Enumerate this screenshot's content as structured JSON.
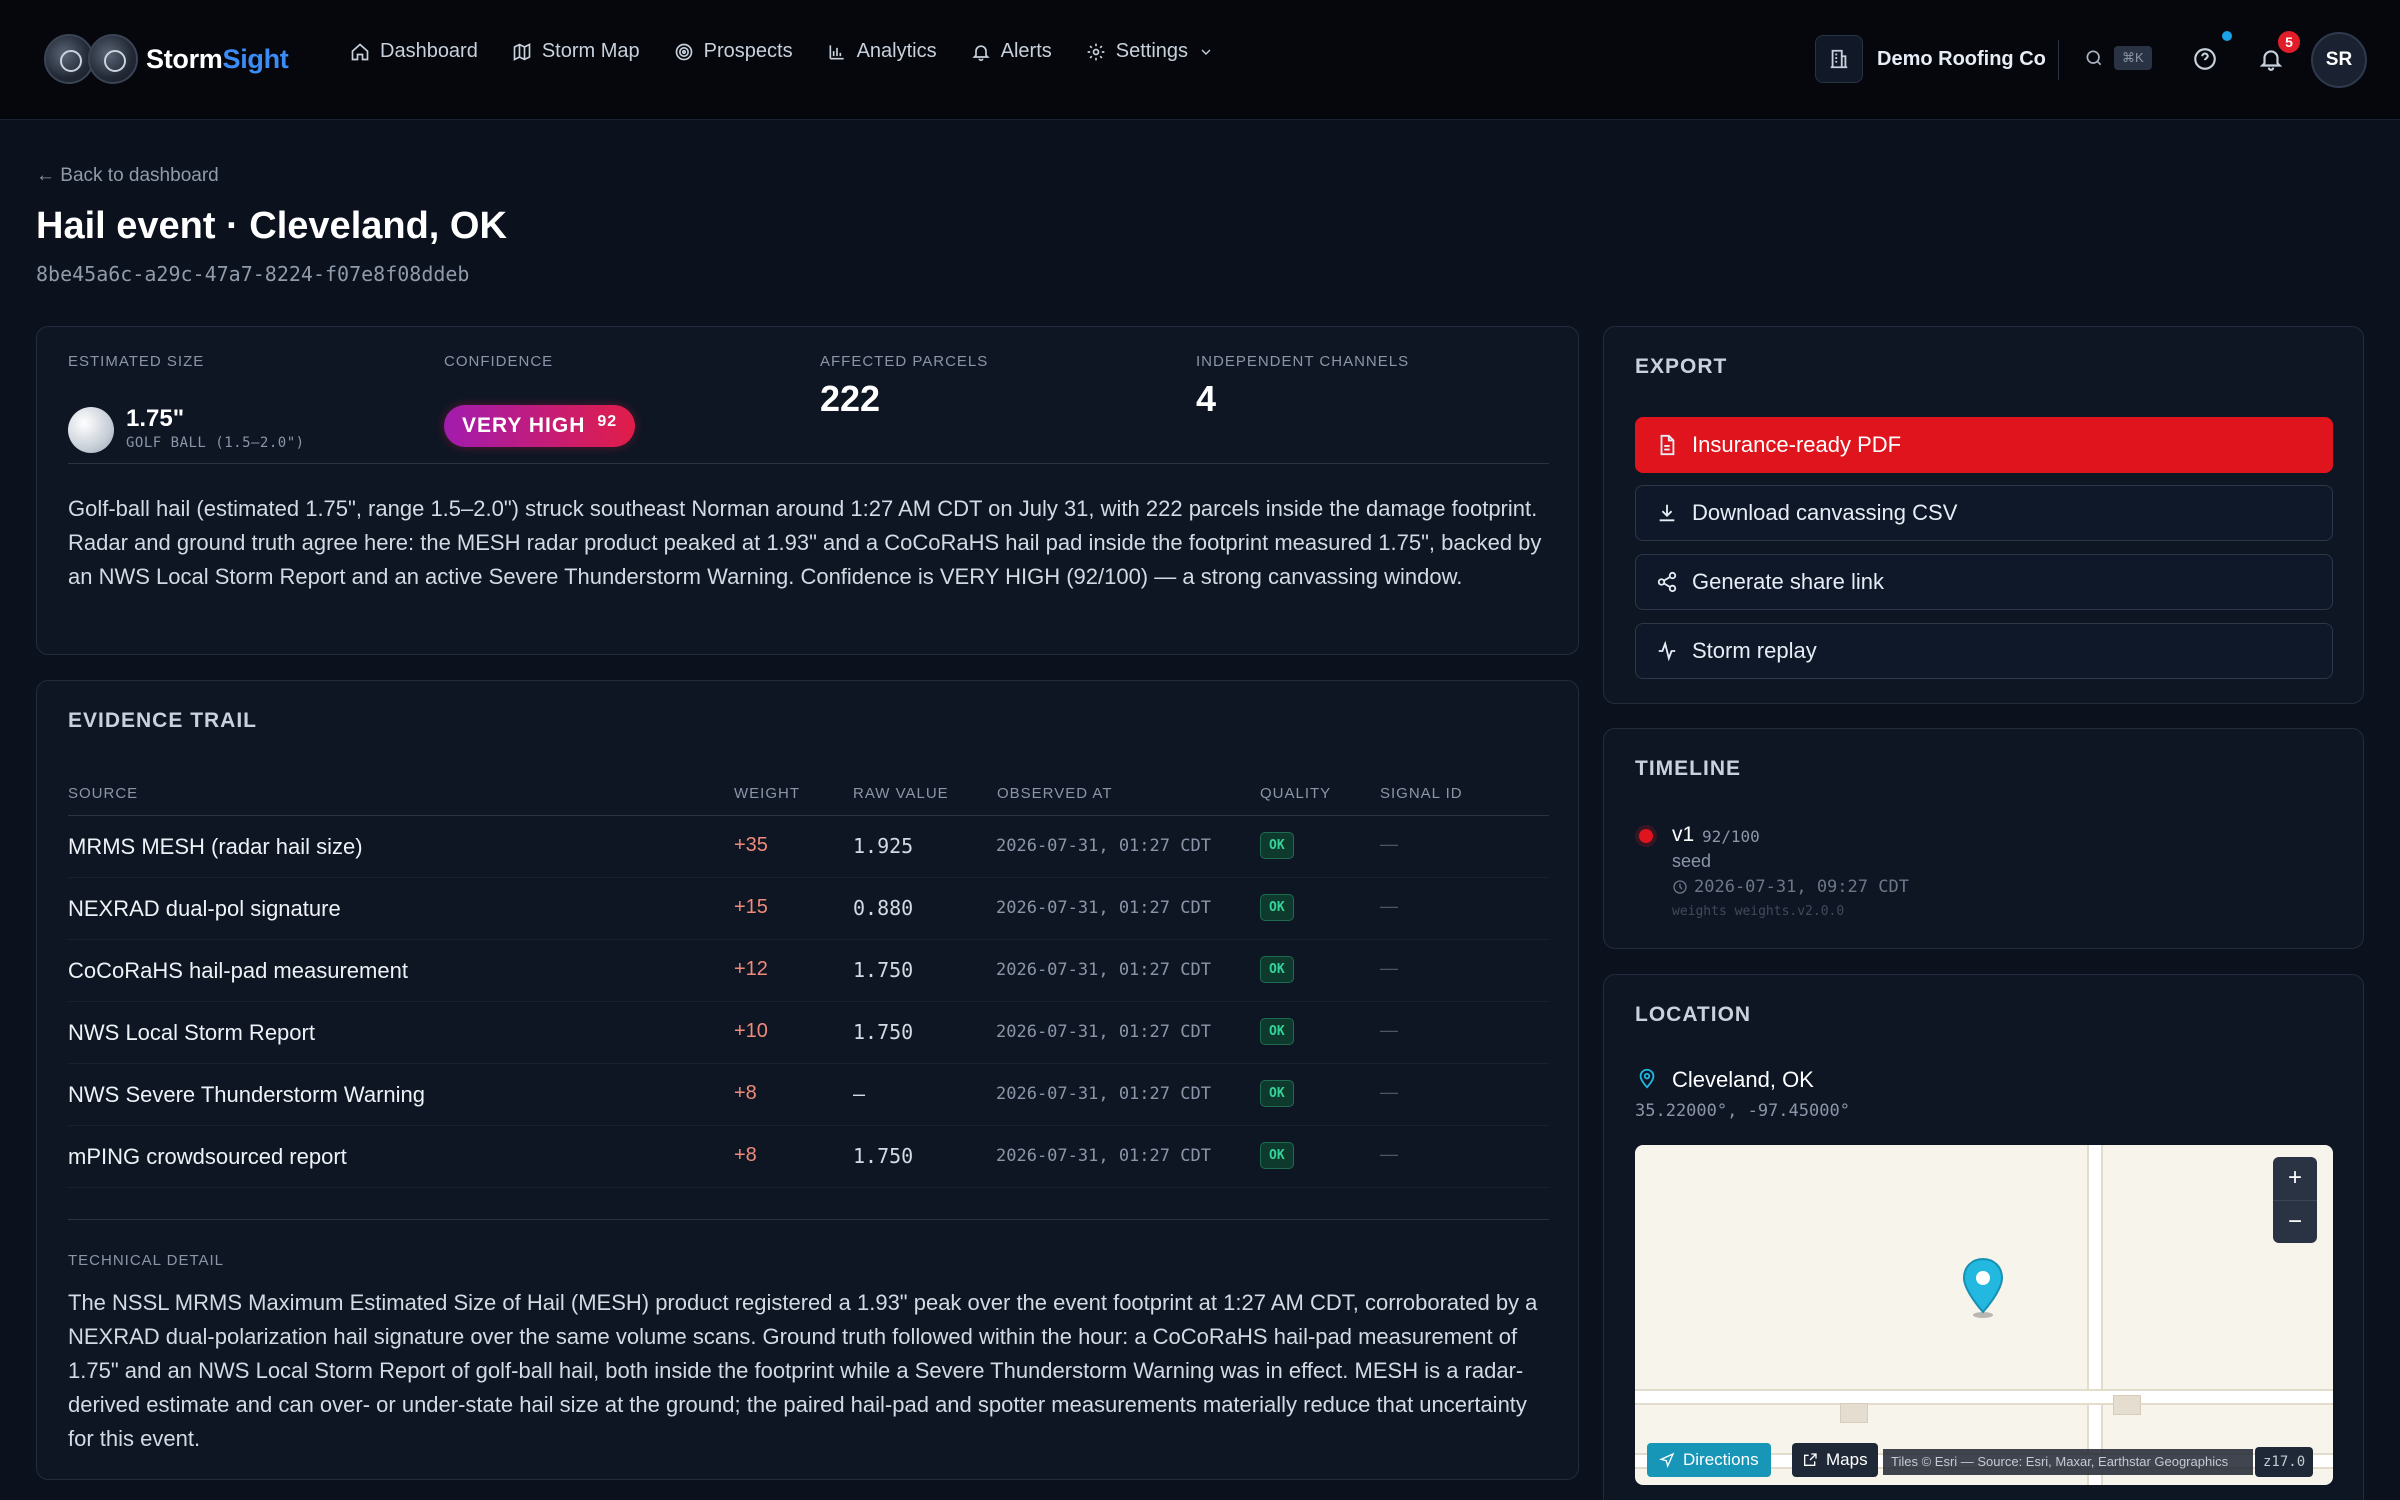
{
  "app": {
    "name_main": "Storm",
    "name_accent": "Sight"
  },
  "nav": [
    {
      "label": "Dashboard",
      "icon": "home-icon"
    },
    {
      "label": "Storm Map",
      "icon": "map-icon"
    },
    {
      "label": "Prospects",
      "icon": "target-icon"
    },
    {
      "label": "Analytics",
      "icon": "bar-chart-icon"
    },
    {
      "label": "Alerts",
      "icon": "bell-icon"
    },
    {
      "label": "Settings",
      "icon": "gear-icon"
    }
  ],
  "org": {
    "name": "Demo Roofing Co"
  },
  "search": {
    "shortcut": "⌘K"
  },
  "notifications": {
    "count": "5"
  },
  "user": {
    "initials": "SR"
  },
  "header": {
    "back": "← Back to dashboard",
    "title": "Hail event · Cleveland, OK",
    "event_id": "8be45a6c-a29c-47a7-8224-f07e8f08ddeb"
  },
  "summary": {
    "size_label": "ESTIMATED SIZE",
    "size_value": "1.75\"",
    "size_desc": "GOLF BALL (1.5–2.0\")",
    "confidence_label": "CONFIDENCE",
    "confidence_value": "VERY HIGH",
    "confidence_score": "92",
    "parcels_label": "AFFECTED PARCELS",
    "parcels_value": "222",
    "channels_label": "INDEPENDENT CHANNELS",
    "channels_value": "4",
    "narrative": "Golf-ball hail (estimated 1.75\", range 1.5–2.0\") struck southeast Norman around 1:27 AM CDT on July 31, with 222 parcels inside the damage footprint. Radar and ground truth agree here: the MESH radar product peaked at 1.93\" and a CoCoRaHS hail pad inside the footprint measured 1.75\", backed by an NWS Local Storm Report and an active Severe Thunderstorm Warning. Confidence is VERY HIGH (92/100) — a strong canvassing window."
  },
  "evidence": {
    "title": "EVIDENCE TRAIL",
    "columns": [
      "SOURCE",
      "WEIGHT",
      "RAW VALUE",
      "OBSERVED AT",
      "QUALITY",
      "SIGNAL ID"
    ],
    "rows": [
      {
        "source": "MRMS MESH (radar hail size)",
        "weight": "+35",
        "raw": "1.925",
        "observed": "2026-07-31, 01:27 CDT",
        "quality": "OK",
        "signal": "—"
      },
      {
        "source": "NEXRAD dual-pol signature",
        "weight": "+15",
        "raw": "0.880",
        "observed": "2026-07-31, 01:27 CDT",
        "quality": "OK",
        "signal": "—"
      },
      {
        "source": "CoCoRaHS hail-pad measurement",
        "weight": "+12",
        "raw": "1.750",
        "observed": "2026-07-31, 01:27 CDT",
        "quality": "OK",
        "signal": "—"
      },
      {
        "source": "NWS Local Storm Report",
        "weight": "+10",
        "raw": "1.750",
        "observed": "2026-07-31, 01:27 CDT",
        "quality": "OK",
        "signal": "—"
      },
      {
        "source": "NWS Severe Thunderstorm Warning",
        "weight": "+8",
        "raw": "—",
        "observed": "2026-07-31, 01:27 CDT",
        "quality": "OK",
        "signal": "—"
      },
      {
        "source": "mPING crowdsourced report",
        "weight": "+8",
        "raw": "1.750",
        "observed": "2026-07-31, 01:27 CDT",
        "quality": "OK",
        "signal": "—"
      }
    ],
    "tech_label": "TECHNICAL DETAIL",
    "tech_text": "The NSSL MRMS Maximum Estimated Size of Hail (MESH) product registered a 1.93\" peak over the event footprint at 1:27 AM CDT, corroborated by a NEXRAD dual-polarization hail signature over the same volume scans. Ground truth followed within the hour: a CoCoRaHS hail-pad measurement of 1.75\" and an NWS Local Storm Report of golf-ball hail, both inside the footprint while a Severe Thunderstorm Warning was in effect. MESH is a radar-derived estimate and can over- or under-state hail size at the ground; the paired hail-pad and spotter measurements materially reduce that uncertainty for this event."
  },
  "export": {
    "title": "EXPORT",
    "buttons": [
      {
        "label": "Insurance-ready PDF",
        "icon": "file-icon"
      },
      {
        "label": "Download canvassing CSV",
        "icon": "download-icon"
      },
      {
        "label": "Generate share link",
        "icon": "share-icon"
      },
      {
        "label": "Storm replay",
        "icon": "activity-icon"
      }
    ],
    "primary_color": "#e0141c"
  },
  "timeline": {
    "title": "TIMELINE",
    "version": "v1",
    "score": "92/100",
    "note": "seed",
    "time": "2026-07-31, 09:27 CDT",
    "weights": "weights weights.v2.0.0"
  },
  "location": {
    "title": "LOCATION",
    "name": "Cleveland, OK",
    "coords": "35.22000°, -97.45000°",
    "directions": "Directions",
    "maps": "Maps",
    "attribution": "Tiles © Esri — Source: Esri, Maxar, Earthstar Geographics",
    "zoom": "z17.0",
    "zoom_in": "+",
    "zoom_out": "−"
  }
}
